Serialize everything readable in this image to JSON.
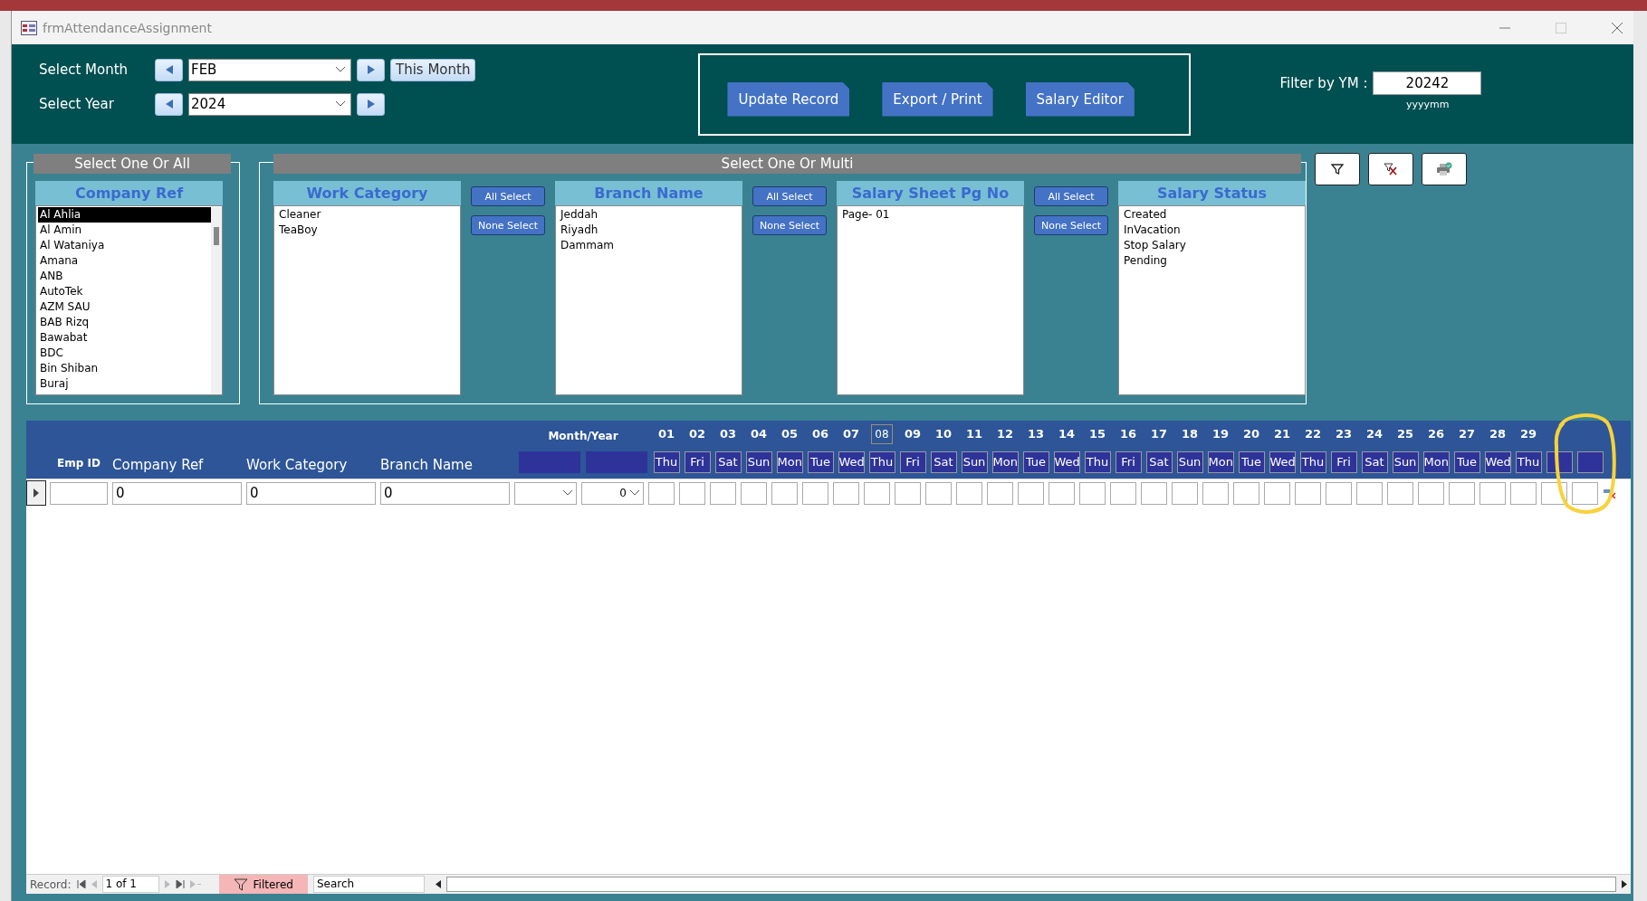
{
  "window": {
    "title": "frmAttendanceAssignment"
  },
  "header": {
    "month_label": "Select Month",
    "month_value": "FEB",
    "this_month_button": "This Month",
    "year_label": "Select Year",
    "year_value": "2024",
    "buttons": [
      "Update Record",
      "Export / Print",
      "Salary Editor"
    ],
    "filter_label": "Filter by YM :",
    "filter_value": "20242",
    "filter_hint": "yyyymm"
  },
  "filters": {
    "single_title": "Select One Or All",
    "multi_title": "Select One Or Multi",
    "company": {
      "title": "Company Ref",
      "items": [
        {
          "label": "Al Ahlia",
          "selected": true
        },
        {
          "label": "Al Amin",
          "selected": false
        },
        {
          "label": "Al Wataniya",
          "selected": false
        },
        {
          "label": "Amana",
          "selected": false
        },
        {
          "label": "ANB",
          "selected": false
        },
        {
          "label": "AutoTek",
          "selected": false
        },
        {
          "label": "AZM SAU",
          "selected": false
        },
        {
          "label": "BAB Rizq",
          "selected": false
        },
        {
          "label": "Bawabat",
          "selected": false
        },
        {
          "label": "BDC",
          "selected": false
        },
        {
          "label": "Bin Shiban",
          "selected": false
        },
        {
          "label": "Buraj",
          "selected": false
        }
      ]
    },
    "lists": [
      {
        "title": "Work Category",
        "items": [
          {
            "label": "Cleaner",
            "selected": false
          },
          {
            "label": "TeaBoy",
            "selected": false
          }
        ],
        "buttons": [
          "All Select",
          "None Select"
        ]
      },
      {
        "title": "Branch  Name",
        "items": [
          {
            "label": "Jeddah",
            "selected": false
          },
          {
            "label": "Riyadh",
            "selected": false
          },
          {
            "label": "Dammam",
            "selected": false
          }
        ],
        "buttons": [
          "All Select",
          "None Select"
        ]
      },
      {
        "title": "Salary Sheet Pg No",
        "items": [
          {
            "label": "Page- 01",
            "selected": false
          }
        ],
        "buttons": [
          "All Select",
          "None Select"
        ]
      },
      {
        "title": "Salary Status",
        "items": [
          {
            "label": "Created",
            "selected": false
          },
          {
            "label": "InVacation",
            "selected": false
          },
          {
            "label": "Stop Salary",
            "selected": false
          },
          {
            "label": "Pending",
            "selected": false
          }
        ]
      }
    ]
  },
  "grid": {
    "columns": [
      "Emp ID",
      "Company Ref",
      "Work Category",
      "Branch Name"
    ],
    "month_year_label": "Month/Year",
    "days": [
      {
        "num": "01",
        "weekday": "Thu",
        "selected": false
      },
      {
        "num": "02",
        "weekday": "Fri",
        "selected": false
      },
      {
        "num": "03",
        "weekday": "Sat",
        "selected": false
      },
      {
        "num": "04",
        "weekday": "Sun",
        "selected": false
      },
      {
        "num": "05",
        "weekday": "Mon",
        "selected": false
      },
      {
        "num": "06",
        "weekday": "Tue",
        "selected": false
      },
      {
        "num": "07",
        "weekday": "Wed",
        "selected": false
      },
      {
        "num": "08",
        "weekday": "Thu",
        "selected": true
      },
      {
        "num": "09",
        "weekday": "Fri",
        "selected": false
      },
      {
        "num": "10",
        "weekday": "Sat",
        "selected": false
      },
      {
        "num": "11",
        "weekday": "Sun",
        "selected": false
      },
      {
        "num": "12",
        "weekday": "Mon",
        "selected": false
      },
      {
        "num": "13",
        "weekday": "Tue",
        "selected": false
      },
      {
        "num": "14",
        "weekday": "Wed",
        "selected": false
      },
      {
        "num": "15",
        "weekday": "Thu",
        "selected": false
      },
      {
        "num": "16",
        "weekday": "Fri",
        "selected": false
      },
      {
        "num": "17",
        "weekday": "Sat",
        "selected": false
      },
      {
        "num": "18",
        "weekday": "Sun",
        "selected": false
      },
      {
        "num": "19",
        "weekday": "Mon",
        "selected": false
      },
      {
        "num": "20",
        "weekday": "Tue",
        "selected": false
      },
      {
        "num": "21",
        "weekday": "Wed",
        "selected": false
      },
      {
        "num": "22",
        "weekday": "Thu",
        "selected": false
      },
      {
        "num": "23",
        "weekday": "Fri",
        "selected": false
      },
      {
        "num": "24",
        "weekday": "Sat",
        "selected": false
      },
      {
        "num": "25",
        "weekday": "Sun",
        "selected": false
      },
      {
        "num": "26",
        "weekday": "Mon",
        "selected": false
      },
      {
        "num": "27",
        "weekday": "Tue",
        "selected": false
      },
      {
        "num": "28",
        "weekday": "Wed",
        "selected": false
      },
      {
        "num": "29",
        "weekday": "Thu",
        "selected": false
      }
    ],
    "row": {
      "company_ref": "0",
      "work_category": "0",
      "branch_name": "0",
      "year": "0"
    }
  },
  "status_bar": {
    "record_label": "Record:",
    "position": "1 of 1",
    "filter_state": "Filtered",
    "search": "Search"
  }
}
